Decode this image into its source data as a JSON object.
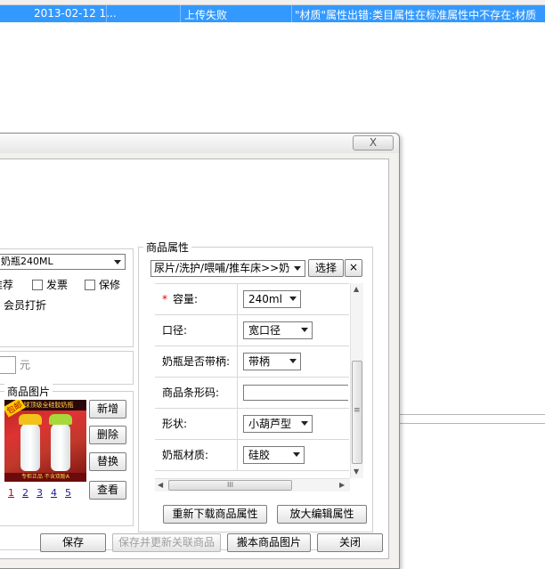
{
  "background": {
    "row": {
      "date": "2013-02-12 1...",
      "status": "上传失败",
      "message": "\"材质\"属性出错:类目属性在标准属性中不存在:材质"
    }
  },
  "dialog": {
    "close_label": "X",
    "product_name_value": "奶瓶240ML",
    "options": {
      "recommend": "推荐",
      "invoice": "发票",
      "warranty": "保修"
    },
    "member_discount": "会员打折",
    "price_unit": "元",
    "images": {
      "legend": "商品图片",
      "thumb_banner": "全球顶级全硅胶奶瓶",
      "thumb_tag": "包邮",
      "thumb_footer": "专柜正品  不含双酚A",
      "buttons": {
        "add": "新增",
        "delete": "删除",
        "replace": "替换",
        "view": "查看"
      },
      "pages": [
        "1",
        "2",
        "3",
        "4",
        "5"
      ]
    },
    "attributes": {
      "legend": "商品属性",
      "category": "尿片/洗护/喂哺/推车床>>奶",
      "choose_button": "选择",
      "clear_button": "×",
      "rows": [
        {
          "label": "容量:",
          "required": "*",
          "value": "240ml"
        },
        {
          "label": "口径:",
          "value": "宽口径"
        },
        {
          "label": "奶瓶是否带柄:",
          "value": "带柄"
        },
        {
          "label": "商品条形码:",
          "value": ""
        },
        {
          "label": "形状:",
          "value": "小葫芦型"
        },
        {
          "label": "奶瓶材质:",
          "value": "硅胶"
        }
      ],
      "scroll_grip": "III",
      "vscroll_grip": "≡",
      "reload_button": "重新下载商品属性",
      "expand_button": "放大编辑属性"
    },
    "footer": {
      "save": "保存",
      "save_update": "保存并更新关联商品",
      "move_images": "搬本商品图片",
      "close": "关闭"
    }
  }
}
